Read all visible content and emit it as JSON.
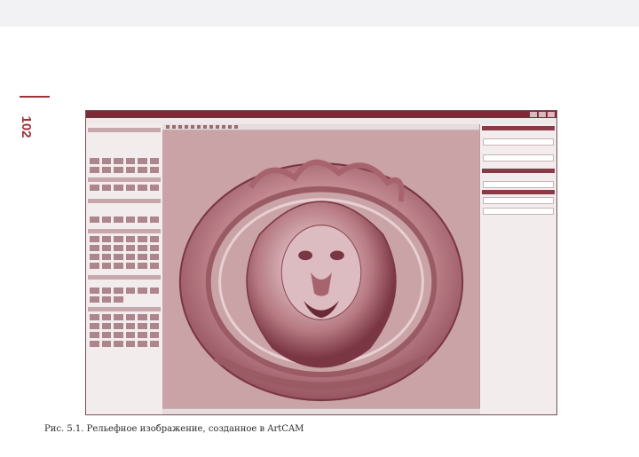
{
  "page": {
    "number": "102",
    "accent_color": "#a0313a"
  },
  "figure": {
    "caption": "Рис. 5.1. Рельефное изображение, созданное в ArtCAM"
  },
  "artcam_screenshot": {
    "title_bar_color": "#7a2c38",
    "viewport_color": "#c9a3a6",
    "viewport_subject": "relief-lion-head-medallion"
  }
}
